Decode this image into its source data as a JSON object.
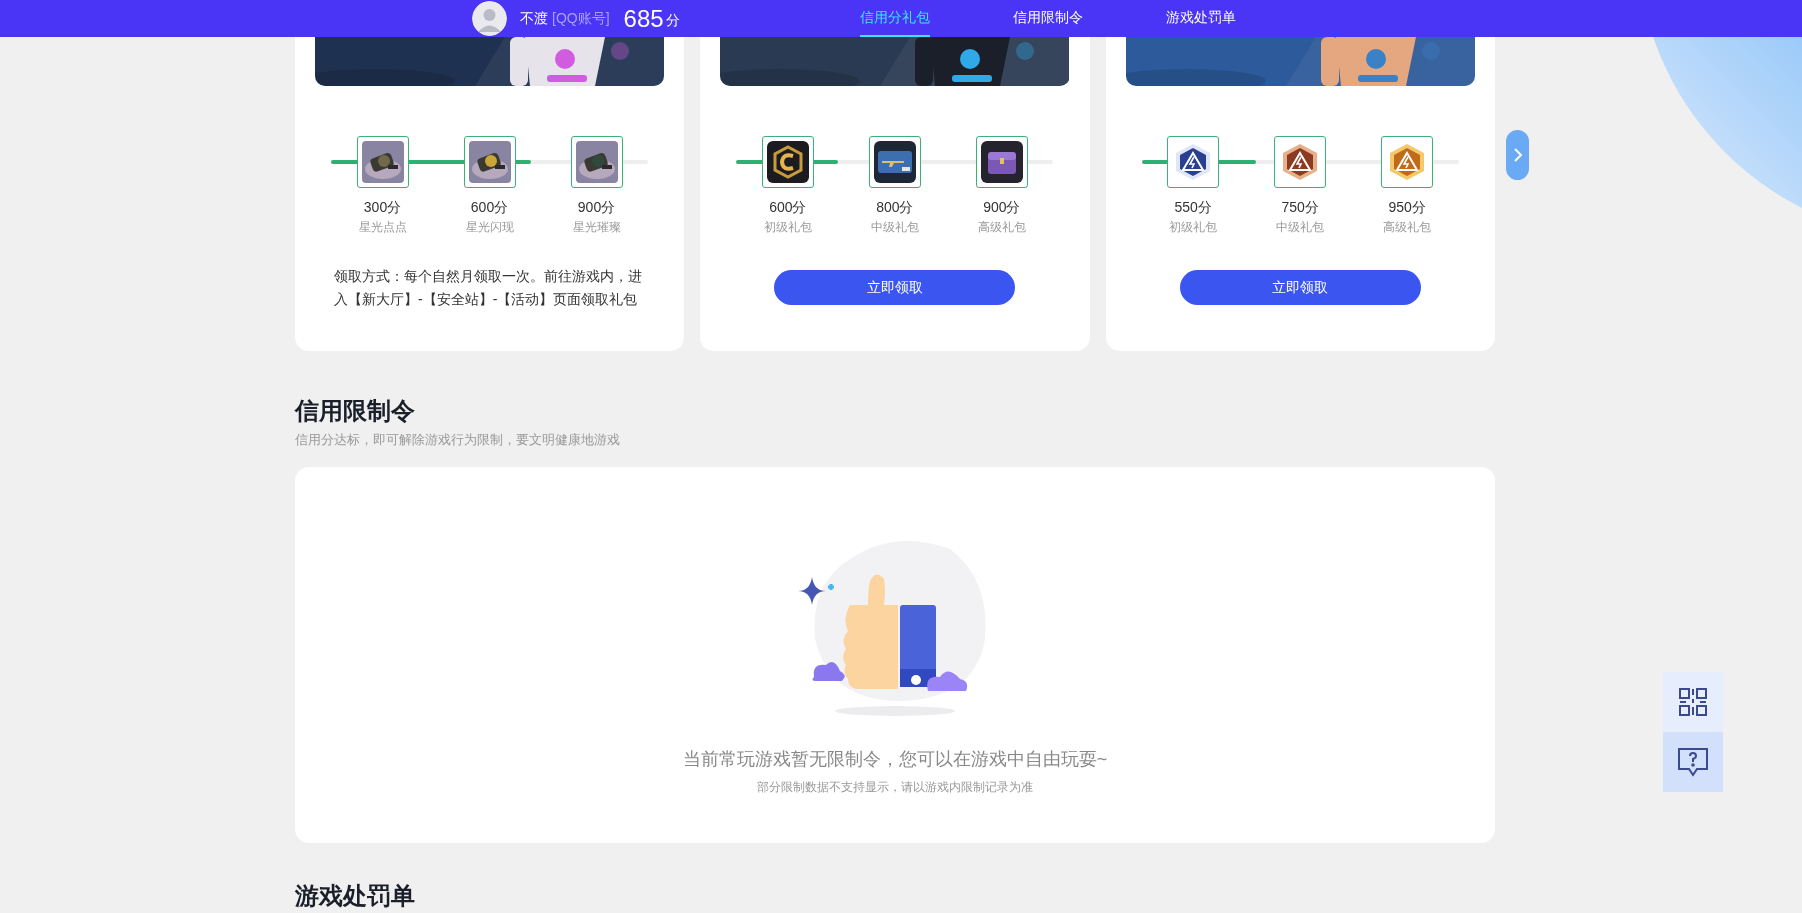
{
  "top_bar": {
    "user": {
      "name": "不渡",
      "account_type": "[QQ账号]",
      "score": "685",
      "score_unit": "分"
    },
    "tabs": [
      {
        "label": "信用分礼包",
        "selected": true
      },
      {
        "label": "信用限制令",
        "selected": false
      },
      {
        "label": "游戏处罚单",
        "selected": false
      }
    ]
  },
  "gift_cards": [
    {
      "track": {
        "level": 0.63
      },
      "rewards": [
        {
          "points": "300分",
          "name": "星光点点"
        },
        {
          "points": "600分",
          "name": "星光闪现"
        },
        {
          "points": "900分",
          "name": "星光璀璨"
        }
      ],
      "footer": {
        "kind": "note",
        "text": "领取方式：每个自然月领取一次。前往游戏内，进入【新大厅】-【安全站】-【活动】页面领取礼包"
      }
    },
    {
      "track": {
        "level": 0.32
      },
      "rewards": [
        {
          "points": "600分",
          "name": "初级礼包"
        },
        {
          "points": "800分",
          "name": "中级礼包"
        },
        {
          "points": "900分",
          "name": "高级礼包"
        }
      ],
      "footer": {
        "kind": "button",
        "text": "立即领取"
      }
    },
    {
      "track": {
        "level": 0.36
      },
      "rewards": [
        {
          "points": "550分",
          "name": "初级礼包"
        },
        {
          "points": "750分",
          "name": "中级礼包"
        },
        {
          "points": "950分",
          "name": "高级礼包"
        }
      ],
      "footer": {
        "kind": "button",
        "text": "立即领取"
      }
    }
  ],
  "restriction_section": {
    "title": "信用限制令",
    "subtitle": "信用分达标，即可解除游戏行为限制，要文明健康地游戏",
    "empty_state": {
      "message": "当前常玩游戏暂无限制令，您可以在游戏中自由玩耍~",
      "hint": "部分限制数据不支持显示，请以游戏内限制记录为准"
    }
  },
  "penalty_section": {
    "title": "游戏处罚单"
  }
}
